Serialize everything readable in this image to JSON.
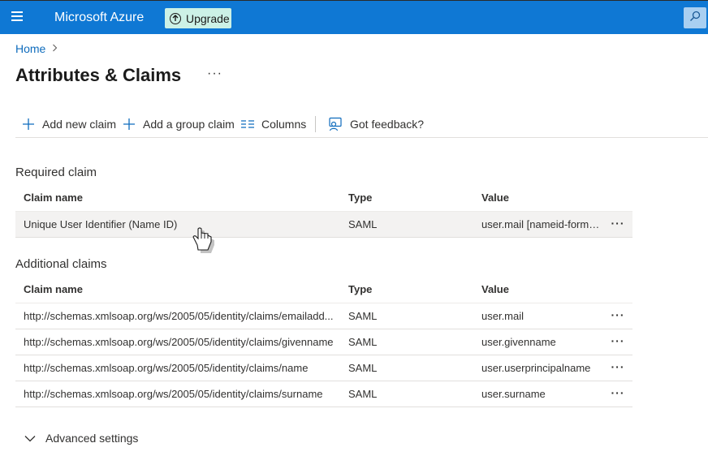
{
  "topbar": {
    "brand": "Microsoft Azure",
    "upgrade_label": "Upgrade",
    "upgrade_icon": "arrow-up-circle-icon",
    "search_icon": "search-icon",
    "color_bg": "#0f78d4",
    "color_upgrade": "#ccf1e6"
  },
  "breadcrumb": {
    "home": "Home",
    "separator_icon": "chevron-right-icon"
  },
  "page": {
    "title": "Attributes & Claims",
    "more": "···"
  },
  "toolbar": {
    "add_claim": "Add new claim",
    "add_group_claim": "Add a group claim",
    "columns": "Columns",
    "feedback": "Got feedback?"
  },
  "required": {
    "title": "Required claim",
    "columns": {
      "name": "Claim name",
      "type": "Type",
      "value": "Value"
    },
    "rows": [
      {
        "name": "Unique User Identifier (Name ID)",
        "type": "SAML",
        "value": "user.mail [nameid-forma...",
        "more": "···"
      }
    ]
  },
  "additional": {
    "title": "Additional claims",
    "columns": {
      "name": "Claim name",
      "type": "Type",
      "value": "Value"
    },
    "rows": [
      {
        "name": "http://schemas.xmlsoap.org/ws/2005/05/identity/claims/emailadd...",
        "type": "SAML",
        "value": "user.mail",
        "more": "···"
      },
      {
        "name": "http://schemas.xmlsoap.org/ws/2005/05/identity/claims/givenname",
        "type": "SAML",
        "value": "user.givenname",
        "more": "···"
      },
      {
        "name": "http://schemas.xmlsoap.org/ws/2005/05/identity/claims/name",
        "type": "SAML",
        "value": "user.userprincipalname",
        "more": "···"
      },
      {
        "name": "http://schemas.xmlsoap.org/ws/2005/05/identity/claims/surname",
        "type": "SAML",
        "value": "user.surname",
        "more": "···"
      }
    ]
  },
  "advanced_settings": "Advanced settings"
}
